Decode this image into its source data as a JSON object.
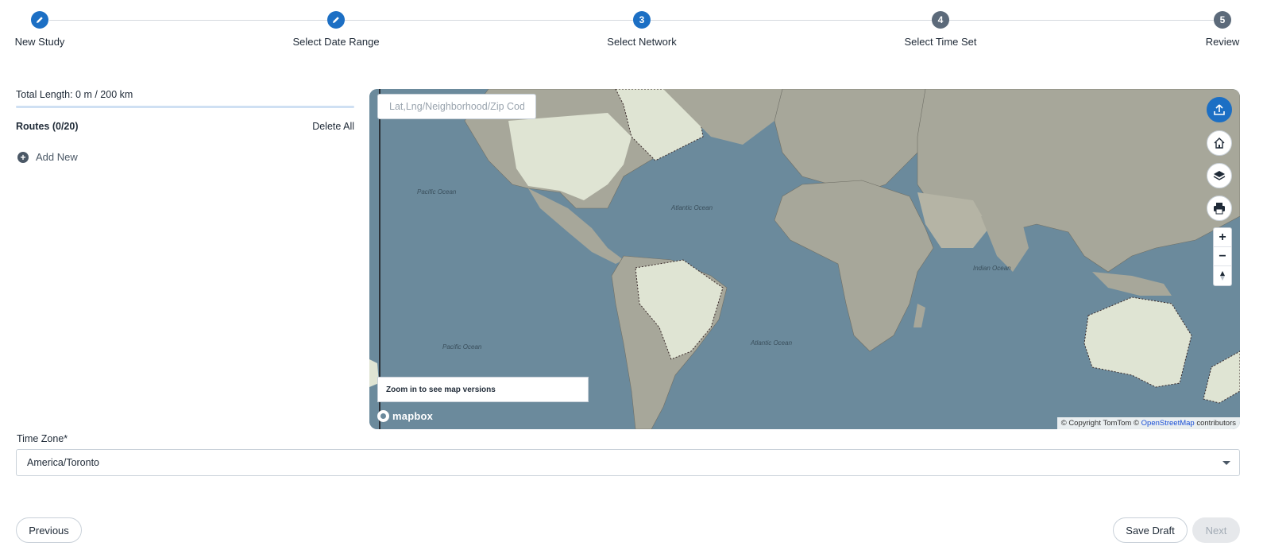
{
  "stepper": {
    "steps": [
      {
        "number": "",
        "label": "New Study",
        "state": "done"
      },
      {
        "number": "",
        "label": "Select Date Range",
        "state": "done"
      },
      {
        "number": "3",
        "label": "Select Network",
        "state": "active"
      },
      {
        "number": "4",
        "label": "Select Time Set",
        "state": "pending"
      },
      {
        "number": "5",
        "label": "Review",
        "state": "pending"
      }
    ]
  },
  "routes_panel": {
    "total_length": "Total Length: 0 m / 200 km",
    "length_progress": 0,
    "routes_title": "Routes (0/20)",
    "delete_all": "Delete All",
    "add_new": "Add New"
  },
  "map": {
    "search_placeholder": "Lat,Lng/Neighborhood/Zip Cod",
    "zoom_banner": "Zoom in to see map versions",
    "logo_text": "mapbox",
    "attribution_prefix": "© Copyright TomTom ©",
    "attribution_link": "OpenStreetMap",
    "attribution_suffix": "contributors",
    "ocean_labels": [
      "Pacific Ocean",
      "Atlantic Ocean",
      "Indian Ocean",
      "Pacific Ocean",
      "Atlantic Ocean"
    ],
    "controls": [
      "upload-icon",
      "home-icon",
      "layers-icon",
      "print-icon"
    ],
    "zoom_in": "+",
    "zoom_out": "−"
  },
  "time_zone": {
    "label": "Time Zone*",
    "value": "America/Toronto"
  },
  "footer": {
    "previous": "Previous",
    "save_draft": "Save Draft",
    "next": "Next"
  },
  "colors": {
    "primary": "#1c6fc4",
    "pending": "#5c6a7a",
    "ocean": "#6b8a9c",
    "land": "#a7a79a"
  }
}
